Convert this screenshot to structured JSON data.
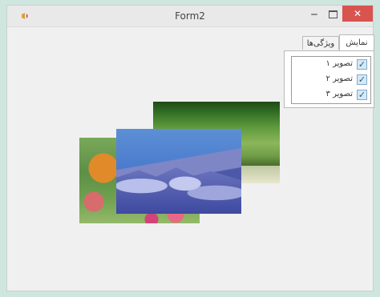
{
  "window": {
    "title": "Form2"
  },
  "titlebar": {
    "icon": "app-window-icon",
    "minimize_label": "‒",
    "close_label": "✕"
  },
  "tabs": [
    {
      "label": "نمایش",
      "active": true
    },
    {
      "label": "ویژگی‌ها",
      "active": false
    }
  ],
  "checklist": {
    "items": [
      {
        "label": "تصویر ۱",
        "checked": true
      },
      {
        "label": "تصویر ۲",
        "checked": true
      },
      {
        "label": "تصویر ۳",
        "checked": true
      }
    ],
    "check_glyph": "✓"
  },
  "images": [
    {
      "name": "photo-grass",
      "description_icon": "grass"
    },
    {
      "name": "photo-butterfly",
      "description_icon": "butterfly"
    },
    {
      "name": "photo-mountain",
      "description_icon": "mountain"
    }
  ],
  "colors": {
    "background": "#cfe6df",
    "close_button": "#d9534f",
    "check_box": "#d5e8f4"
  }
}
